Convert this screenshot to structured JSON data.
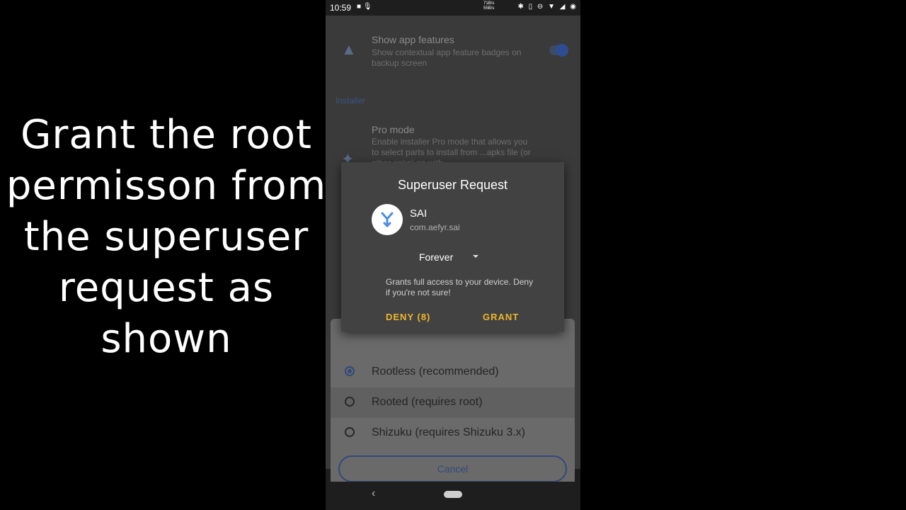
{
  "caption": {
    "lines": [
      "Grant the root",
      "permisson from",
      "the superuser",
      "request as",
      "shown"
    ]
  },
  "statusbar": {
    "time": "10:59",
    "speed_up": "71B/s",
    "speed_down": "55B/s"
  },
  "settings": {
    "app_features": {
      "title": "Show app features",
      "subtitle": "Show contextual app feature badges on backup screen",
      "enabled": true
    },
    "section_installer": "Installer",
    "pro_mode": {
      "title": "Pro mode",
      "subtitle": "Enable installer Pro mode that allows you to select parts to install from ...apks file (or other apks) as with"
    }
  },
  "installer_sheet": {
    "options": [
      {
        "label": "Rootless (recommended)",
        "selected": true
      },
      {
        "label": "Rooted (requires root)",
        "selected": false
      },
      {
        "label": "Shizuku (requires Shizuku 3.x)",
        "selected": false
      }
    ],
    "cancel_label": "Cancel"
  },
  "dialog": {
    "title": "Superuser Request",
    "app_name": "SAI",
    "app_package": "com.aefyr.sai",
    "duration": "Forever",
    "warning": "Grants full access to your device. Deny if you're not sure!",
    "deny_label": "DENY (8)",
    "grant_label": "GRANT"
  },
  "colors": {
    "accent_blue": "#33497a",
    "button_yellow": "#f0b62c",
    "dialog_bg": "#424242"
  }
}
